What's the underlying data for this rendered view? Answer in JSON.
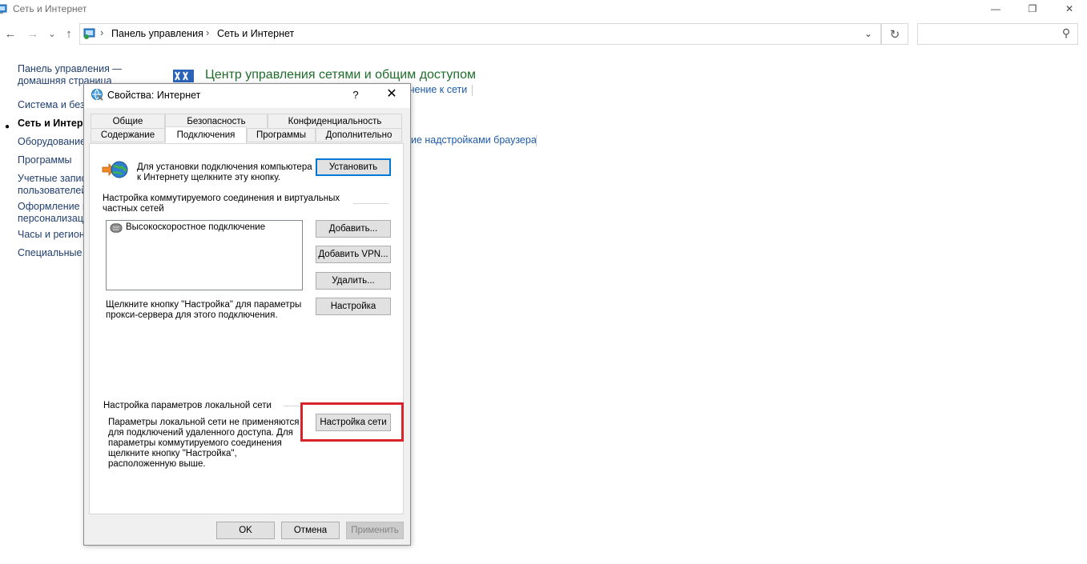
{
  "window": {
    "title": "Сеть и Интернет",
    "minimize_glyph": "—",
    "restore_glyph": "❐",
    "close_glyph": "✕"
  },
  "nav": {
    "back_glyph": "←",
    "forward_glyph": "→",
    "recent_glyph": "⌄",
    "up_glyph": "↑",
    "breadcrumb": [
      "Панель управления",
      "Сеть и Интернет"
    ],
    "separator_glyph": "›",
    "dropdown_glyph": "⌄",
    "refresh_glyph": "↻",
    "search_placeholder": "",
    "search_glyph": "⚲"
  },
  "sidebar": {
    "items": [
      {
        "label": "Панель управления —"
      },
      {
        "label": "домашняя страница"
      },
      {
        "label": "Система и безопасность"
      },
      {
        "label": "Сеть и Интернет"
      },
      {
        "label": "Оборудование и звук"
      },
      {
        "label": "Программы"
      },
      {
        "label": "Учетные записи"
      },
      {
        "label": "пользователей"
      },
      {
        "label": "Оформление и"
      },
      {
        "label": "персонализация"
      },
      {
        "label": "Часы и регион"
      },
      {
        "label": "Специальные возможности"
      }
    ],
    "bullet": "●"
  },
  "main": {
    "category_title": "Центр управления сетями и общим доступом",
    "link1": "чение к сети",
    "link2": "ие надстройками браузера"
  },
  "dialog": {
    "title": "Свойства: Интернет",
    "help_glyph": "?",
    "close_glyph": "✕",
    "tabs_row1": [
      "Общие",
      "Безопасность",
      "Конфиденциальность"
    ],
    "tabs_row2": [
      "Содержание",
      "Подключения",
      "Программы",
      "Дополнительно"
    ],
    "active_tab": "Подключения",
    "setup_text": [
      "Для установки подключения компьютера",
      "к Интернету щелкните эту кнопку."
    ],
    "setup_button": "Установить",
    "dialup_group": [
      "Настройка коммутируемого соединения и виртуальных",
      "частных сетей"
    ],
    "connections": [
      "Высокоскоростное подключение"
    ],
    "add_button": "Добавить...",
    "add_vpn_button": "Добавить VPN...",
    "remove_button": "Удалить...",
    "settings_button": "Настройка",
    "proxy_text": [
      "Щелкните кнопку \"Настройка\" для параметры",
      "прокси-сервера для этого подключения."
    ],
    "lan_group": "Настройка параметров локальной сети",
    "lan_text": [
      "Параметры локальной сети не применяются",
      "для подключений удаленного доступа. Для",
      "параметры коммутируемого соединения",
      "щелкните кнопку \"Настройка\",",
      "расположенную выше."
    ],
    "lan_button": "Настройка сети",
    "ok_button": "OK",
    "cancel_button": "Отмена",
    "apply_button": "Применить"
  },
  "colors": {
    "highlight": "#d8232a",
    "link": "#1e5aa8",
    "category_title": "#1e6c2a",
    "accent": "#0078d7"
  }
}
